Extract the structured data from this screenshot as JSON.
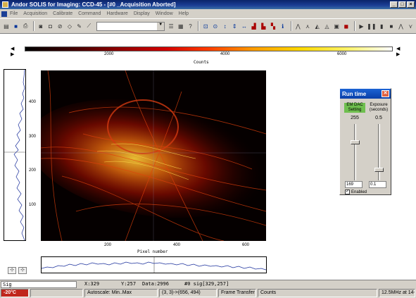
{
  "window": {
    "title": "Andor SOLIS for Imaging: CCD-45 - [#0 _Acquisition Aborted]",
    "buttons": [
      "_",
      "□",
      "×"
    ]
  },
  "menu": [
    "File",
    "Acquisition",
    "Calibrate",
    "Command",
    "Hardware",
    "Display",
    "Window",
    "Help"
  ],
  "colorbar": {
    "left_arrows": "◀ ▶",
    "right_arrows": "◀ ▶",
    "ticks": [
      "2000",
      "4000",
      "6000"
    ],
    "title": "Counts"
  },
  "image": {
    "y_ticks": [
      "400",
      "300",
      "200",
      "100"
    ],
    "x_ticks": [
      "200",
      "400",
      "600"
    ],
    "x_label": "Pixel number"
  },
  "cursor_tools": [
    "⊹",
    "⊹"
  ],
  "runtime": {
    "title": "Run time",
    "em_dac_label": "EM DAC Setting",
    "em_dac_value": "255",
    "exposure_label": "Exposure (seconds)",
    "exposure_value": "0.5",
    "em_dac_input": "169",
    "exposure_input": "0.1",
    "enabled_label": "Enabled",
    "enabled_check": "✓"
  },
  "status_line": {
    "sig": "Sig",
    "x": "X:329",
    "y": "Y:257",
    "data": "Data:2996",
    "roi": "#0 sig[329,257]"
  },
  "statusbar": {
    "temperature": "-20°C",
    "autoscale": "Autoscale: Min..Max",
    "region": "(3, 3)->(656, 494)",
    "mode": "Frame Transfer",
    "units": "Counts",
    "readout": "12.5MHz at 14-bit"
  },
  "colors": {
    "title_blue": "#0a246a",
    "temp_red": "#c0261c",
    "profile_line": "#1a2f9c",
    "em_green": "#6fbf4f"
  }
}
